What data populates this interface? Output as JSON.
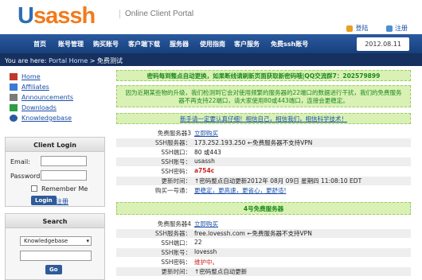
{
  "brand": {
    "logo_u": "U",
    "logo_rest": "sassh",
    "portal": "Online Client Portal"
  },
  "header_links": {
    "login": "登陆",
    "register": "注册"
  },
  "nav": {
    "items": [
      "首页",
      "账号管理",
      "购买账号",
      "客户端下载",
      "服务器",
      "使用指南",
      "客户服务",
      "免费ssh账号"
    ],
    "date": "2012.08.11"
  },
  "breadcrumb": {
    "prefix": "You are here:",
    "home": "Portal Home",
    "sep": " > ",
    "current": "免费测试"
  },
  "sidebar": {
    "links": [
      {
        "label": "Home",
        "icon": "home-icon"
      },
      {
        "label": "Affiliates",
        "icon": "affiliates-icon"
      },
      {
        "label": "Announcements",
        "icon": "announcements-icon"
      },
      {
        "label": "Downloads",
        "icon": "downloads-icon"
      },
      {
        "label": "Knowledgebase",
        "icon": "knowledgebase-icon"
      }
    ],
    "login": {
      "title": "Client Login",
      "email_label": "Email:",
      "password_label": "Password:",
      "remember": "Remember Me",
      "login_button": "Login",
      "register_link": "注册"
    },
    "search": {
      "title": "Search",
      "selected": "Knowledgebase",
      "go": "Go"
    }
  },
  "notices": {
    "n1": "密码每到整点自动更换，如果断线请刷新页面获取新密码哦|QQ交流群7：202579899",
    "n2a": "因为近期某些物的升级，我们检测到它会对使用频繁的服务器的22端口的数据进行干扰，我们的免费服务",
    "n2b": "器不再支持22端口，请大家使用80或443端口，连接会更稳定。",
    "n3": "新手请一定要认真仔细！相信自己，相信我们，相信科学技术！",
    "n4": "4号免费服务器"
  },
  "server3": {
    "title_key": "免费服务器3",
    "title_link": "立即购买",
    "ssh_server_key": "SSH服务器：",
    "ssh_server_val": "173.252.193.250 ←免费服务器不支持VPN",
    "ssh_port_key": "SSH端口：",
    "ssh_port_val": "80 或443",
    "ssh_account_key": "SSH账号：",
    "ssh_account_val": "usassh",
    "ssh_password_key": "SSH密码：",
    "ssh_password_val": "a754c",
    "update_key": "更新时间：",
    "update_val": "↑密码整点自动更新2012年 08月 09日 星期四 11:08:10 EDT",
    "buy_key": "购买一号通：",
    "buy_links": [
      "更稳定，",
      "更高速，",
      "更省心，",
      "更舒适!"
    ]
  },
  "server4": {
    "title_key": "免费服务器4",
    "title_link": "立即购买",
    "ssh_server_key": "SSH服务器：",
    "ssh_server_val": "free.lovessh.com ←免费服务器不支持VPN",
    "ssh_port_key": "SSH端口：",
    "ssh_port_val": "22",
    "ssh_account_key": "SSH账号：",
    "ssh_account_val": "lovessh",
    "ssh_password_key": "SSH密码：",
    "ssh_password_val": "维护中。",
    "update_key": "更新时间：",
    "update_val": "↑密码整点自动更新"
  },
  "colors": {
    "nav": "#17407c",
    "crumb": "#16305f",
    "notice_bg": "#d9f1b4",
    "accent_orange": "#f27a1c",
    "accent_blue": "#2e6db4"
  }
}
